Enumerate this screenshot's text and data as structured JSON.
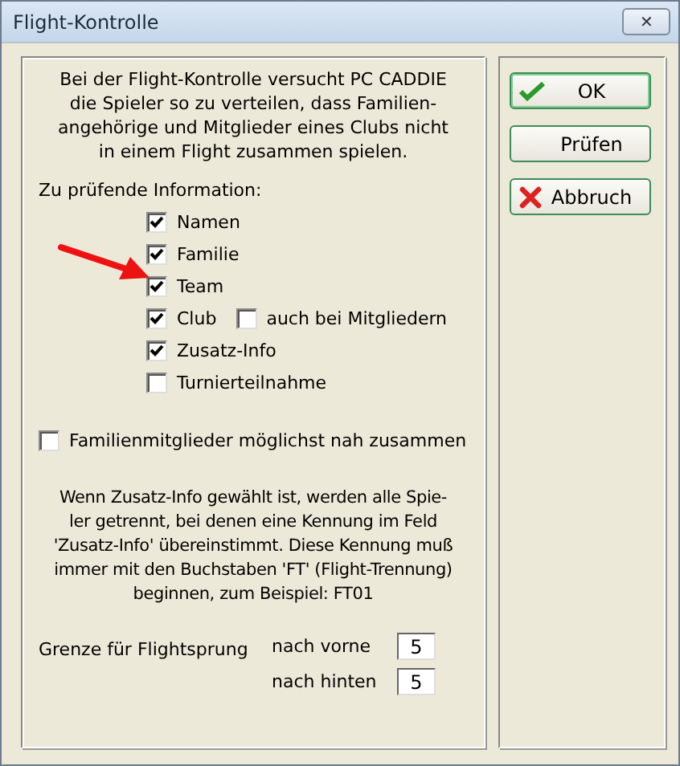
{
  "window": {
    "title": "Flight-Kontrolle",
    "close_label": "✕"
  },
  "description": "Bei der Flight-Kontrolle versucht PC CADDIE\ndie Spieler so zu verteilen, dass Familien-\nangehörige und Mitglieder eines Clubs nicht\nin einem Flight zusammen spielen.",
  "info_label": "Zu prüfende Information:",
  "checks": [
    {
      "label": "Namen",
      "checked": true
    },
    {
      "label": "Familie",
      "checked": true
    },
    {
      "label": "Team",
      "checked": true
    },
    {
      "label": "Club",
      "checked": true,
      "extra": {
        "label": "auch bei Mitgliedern",
        "checked": false
      }
    },
    {
      "label": "Zusatz-Info",
      "checked": true
    },
    {
      "label": "Turnierteilnahme",
      "checked": false
    }
  ],
  "family_option": {
    "label": "Familienmitglieder möglichst nah zusammen",
    "checked": false
  },
  "note": "Wenn Zusatz-Info gewählt ist, werden alle Spie-\nler getrennt, bei denen eine Kennung im Feld\n'Zusatz-Info' übereinstimmt. Diese Kennung muß\nimmer mit den Buchstaben 'FT' (Flight-Trennung)\nbeginnen, zum Beispiel: FT01",
  "limit": {
    "label": "Grenze für Flightsprung",
    "fields": [
      {
        "label": "nach vorne",
        "value": "5"
      },
      {
        "label": "nach hinten",
        "value": "5"
      }
    ]
  },
  "buttons": [
    {
      "label": "OK",
      "kind": "ok",
      "default": true
    },
    {
      "label": "Prüfen",
      "kind": "check",
      "default": false
    },
    {
      "label": "Abbruch",
      "kind": "cancel",
      "default": false
    }
  ]
}
